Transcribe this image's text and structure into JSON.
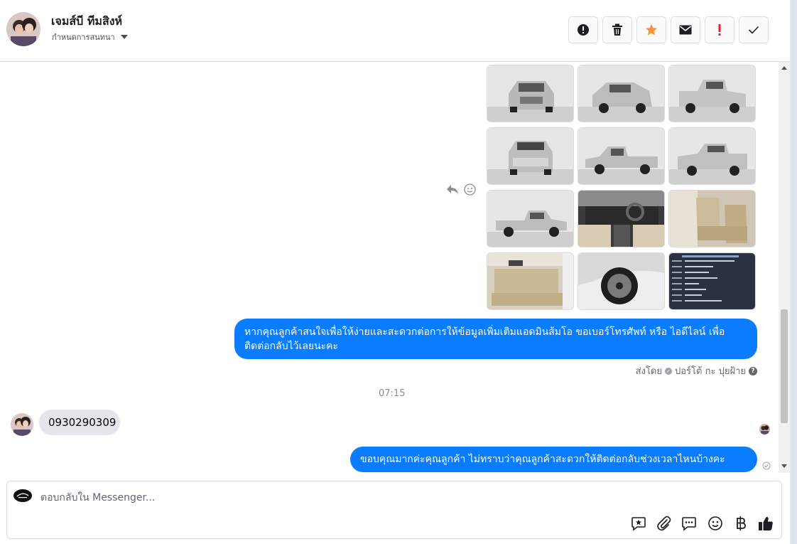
{
  "header": {
    "contact_name": "เจมส์บี ทีมสิงห์",
    "assign_label": "กำหนดการสนทนา"
  },
  "conversation": {
    "outgoing_1": "หากคุณลูกค้าสนใจเพื่อให้ง่ายและสะดวกต่อการให้ข้อมูลเพิ่มเติมแอดมินส้มโอ ขอเบอร์โทรศัพท์ หรือ ไอดีไลน์ เพื่อติดต่อกลับไว้เลยนะคะ",
    "sent_by_prefix": "ส่งโดย",
    "sent_by_name": "ปอร์โต้ กะ ปุยฝ้าย",
    "timestamp": "07:15",
    "incoming_1": "0930290309",
    "outgoing_2": "ขอบคุณมากค่ะคุณลูกค้า ไม่ทราบว่าคุณลูกค้าสะดวกให้ติดต่อกลับช่วงเวลาไหนบ้างคะ"
  },
  "reply_box": {
    "placeholder": "ตอบกลับใน Messenger..."
  },
  "colors": {
    "accent_blue": "#0a7cff",
    "star_orange": "#f7923b",
    "alert_red": "#e41e3f"
  }
}
